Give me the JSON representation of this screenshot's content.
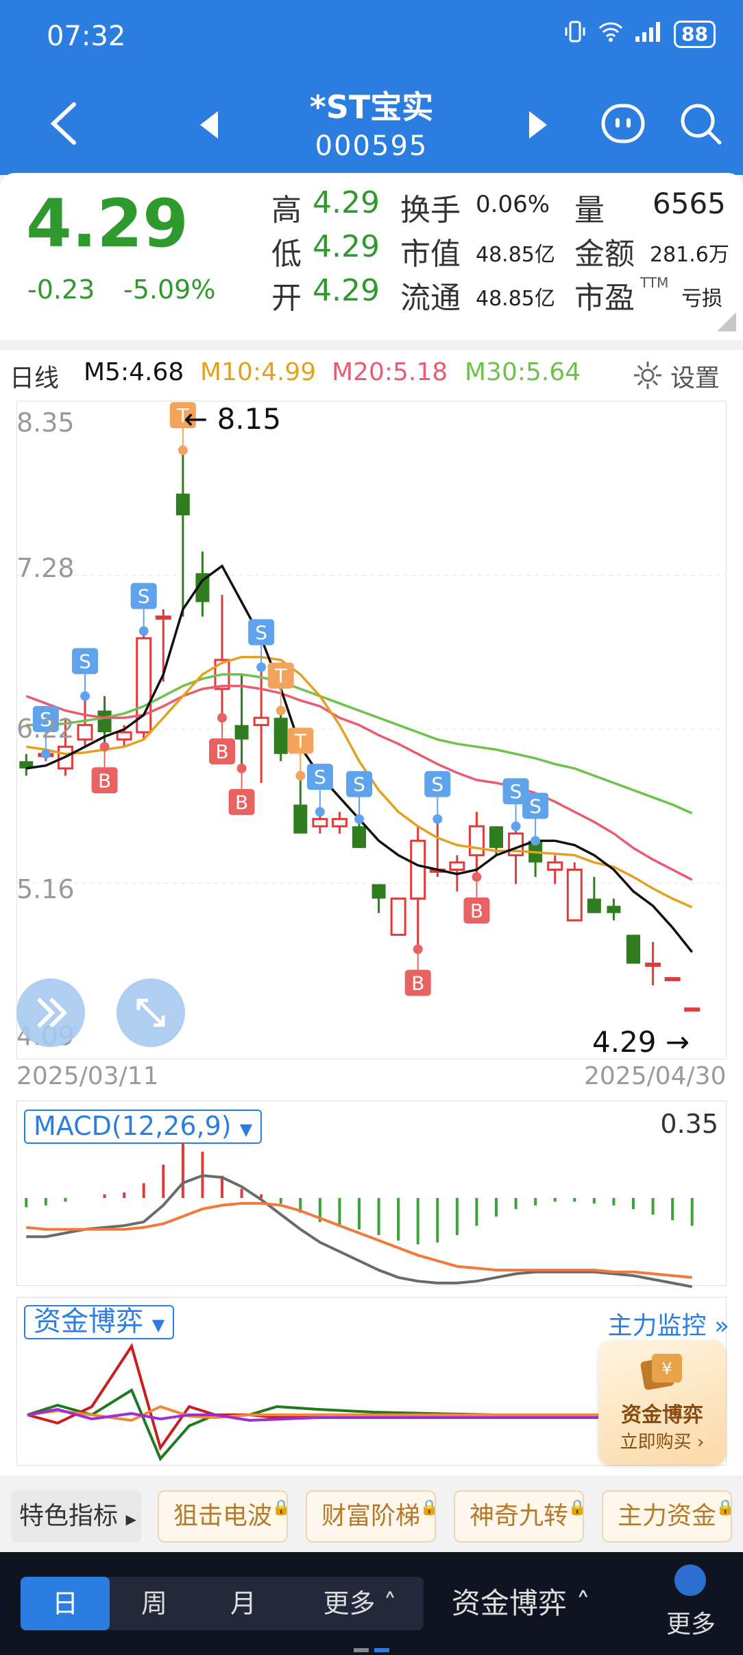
{
  "status": {
    "time": "07:32",
    "battery": "88"
  },
  "header": {
    "title": "*ST宝实",
    "code": "000595"
  },
  "quote": {
    "price": "4.29",
    "change": "-0.23",
    "change_pct": "-5.09%",
    "high_label": "高",
    "high": "4.29",
    "low_label": "低",
    "low": "4.29",
    "open_label": "开",
    "open": "4.29",
    "turnover_label": "换手",
    "turnover": "0.06%",
    "mktcap_label": "市值",
    "mktcap": "48.85亿",
    "float_label": "流通",
    "float": "48.85亿",
    "volume_label": "量",
    "volume": "6565",
    "amount_label": "金额",
    "amount": "281.6万",
    "pe_label": "市盈",
    "pe_sup": "TTM",
    "pe": "亏损"
  },
  "ma_row": {
    "period": "日线",
    "m5": "M5:4.68",
    "m10": "M10:4.99",
    "m20": "M20:5.18",
    "m30": "M30:5.64",
    "settings": "设置"
  },
  "colors": {
    "up": "#e03a3a",
    "down": "#2f7d1f",
    "m5": "#111111",
    "m10": "#e6a020",
    "m20": "#ec5a72",
    "m30": "#6cc24a",
    "accent": "#2b7de0"
  },
  "chart_data": {
    "type": "candlestick",
    "y_ticks": [
      "8.35",
      "7.28",
      "6.22",
      "5.16",
      "4.09"
    ],
    "ylim": [
      4.09,
      8.35
    ],
    "date_start": "2025/03/11",
    "date_end": "2025/04/30",
    "max_label": "8.15",
    "min_label": "4.29",
    "candles": [
      [
        6.0,
        6.05,
        5.9,
        5.95
      ],
      [
        6.05,
        6.05,
        6.0,
        6.05
      ],
      [
        5.95,
        6.3,
        5.9,
        6.1
      ],
      [
        6.15,
        6.45,
        6.1,
        6.25
      ],
      [
        6.35,
        6.45,
        6.1,
        6.2
      ],
      [
        6.15,
        6.25,
        6.1,
        6.2
      ],
      [
        6.2,
        6.9,
        6.15,
        6.85
      ],
      [
        7.0,
        7.05,
        6.55,
        7.0
      ],
      [
        7.85,
        8.15,
        7.0,
        7.7
      ],
      [
        7.3,
        7.45,
        7.0,
        7.1
      ],
      [
        6.5,
        7.15,
        6.3,
        6.7
      ],
      [
        6.25,
        6.6,
        5.95,
        6.15
      ],
      [
        6.25,
        6.65,
        5.85,
        6.3
      ],
      [
        6.3,
        6.35,
        6.0,
        6.05
      ],
      [
        5.7,
        5.9,
        5.5,
        5.5
      ],
      [
        5.55,
        5.65,
        5.5,
        5.6
      ],
      [
        5.55,
        5.65,
        5.5,
        5.6
      ],
      [
        5.55,
        5.6,
        5.4,
        5.4
      ],
      [
        5.15,
        5.15,
        4.95,
        5.05
      ],
      [
        4.8,
        5.05,
        4.8,
        5.05
      ],
      [
        5.05,
        5.55,
        4.7,
        5.45
      ],
      [
        5.25,
        5.6,
        5.2,
        5.25
      ],
      [
        5.25,
        5.35,
        5.1,
        5.3
      ],
      [
        5.35,
        5.65,
        5.2,
        5.55
      ],
      [
        5.55,
        5.55,
        5.35,
        5.4
      ],
      [
        5.35,
        5.55,
        5.15,
        5.5
      ],
      [
        5.45,
        5.45,
        5.2,
        5.3
      ],
      [
        5.25,
        5.35,
        5.15,
        5.3
      ],
      [
        4.9,
        5.3,
        4.9,
        5.25
      ],
      [
        5.05,
        5.2,
        4.95,
        4.95
      ],
      [
        5.0,
        5.05,
        4.9,
        4.95
      ],
      [
        4.8,
        4.8,
        4.6,
        4.6
      ],
      [
        4.6,
        4.75,
        4.45,
        4.6
      ],
      [
        4.5,
        4.5,
        4.5,
        4.5
      ],
      [
        4.29,
        4.29,
        4.29,
        4.29
      ]
    ],
    "m5": [
      5.95,
      5.97,
      6.03,
      6.1,
      6.17,
      6.22,
      6.32,
      6.6,
      7.05,
      7.25,
      7.35,
      7.1,
      6.85,
      6.5,
      6.1,
      5.9,
      5.75,
      5.6,
      5.45,
      5.35,
      5.28,
      5.25,
      5.22,
      5.25,
      5.35,
      5.4,
      5.45,
      5.45,
      5.42,
      5.35,
      5.25,
      5.1,
      5.0,
      4.85,
      4.68
    ],
    "m10": [
      6.1,
      6.08,
      6.05,
      6.06,
      6.08,
      6.1,
      6.15,
      6.3,
      6.45,
      6.6,
      6.68,
      6.72,
      6.72,
      6.7,
      6.6,
      6.45,
      6.25,
      6.0,
      5.8,
      5.65,
      5.55,
      5.47,
      5.42,
      5.4,
      5.38,
      5.38,
      5.37,
      5.36,
      5.35,
      5.3,
      5.27,
      5.2,
      5.12,
      5.05,
      4.99
    ],
    "m20": [
      6.45,
      6.4,
      6.35,
      6.32,
      6.3,
      6.3,
      6.32,
      6.38,
      6.45,
      6.5,
      6.52,
      6.52,
      6.5,
      6.47,
      6.42,
      6.38,
      6.3,
      6.25,
      6.18,
      6.12,
      6.05,
      5.98,
      5.92,
      5.87,
      5.85,
      5.82,
      5.78,
      5.72,
      5.65,
      5.58,
      5.5,
      5.4,
      5.32,
      5.25,
      5.18
    ],
    "m30": [
      6.25,
      6.25,
      6.26,
      6.28,
      6.3,
      6.33,
      6.38,
      6.45,
      6.52,
      6.57,
      6.6,
      6.6,
      6.58,
      6.55,
      6.5,
      6.45,
      6.4,
      6.35,
      6.3,
      6.25,
      6.2,
      6.15,
      6.12,
      6.1,
      6.08,
      6.05,
      6.02,
      5.98,
      5.95,
      5.9,
      5.85,
      5.8,
      5.75,
      5.7,
      5.64
    ],
    "markers": [
      {
        "i": 1,
        "type": "S"
      },
      {
        "i": 3,
        "type": "S"
      },
      {
        "i": 4,
        "type": "B"
      },
      {
        "i": 6,
        "type": "S"
      },
      {
        "i": 8,
        "type": "T"
      },
      {
        "i": 10,
        "type": "B"
      },
      {
        "i": 11,
        "type": "B"
      },
      {
        "i": 12,
        "type": "S"
      },
      {
        "i": 13,
        "type": "T"
      },
      {
        "i": 14,
        "type": "T"
      },
      {
        "i": 15,
        "type": "S"
      },
      {
        "i": 17,
        "type": "S"
      },
      {
        "i": 20,
        "type": "B"
      },
      {
        "i": 21,
        "type": "S"
      },
      {
        "i": 23,
        "type": "B"
      },
      {
        "i": 25,
        "type": "S"
      },
      {
        "i": 26,
        "type": "S"
      }
    ],
    "macd": {
      "label": "MACD(12,26,9)",
      "value": "0.35",
      "bars": [
        -0.05,
        -0.04,
        -0.02,
        0.0,
        0.02,
        0.03,
        0.08,
        0.18,
        0.3,
        0.25,
        0.12,
        0.05,
        0.02,
        -0.03,
        -0.08,
        -0.13,
        -0.15,
        -0.17,
        -0.2,
        -0.23,
        -0.25,
        -0.24,
        -0.2,
        -0.15,
        -0.1,
        -0.06,
        -0.04,
        -0.02,
        -0.02,
        -0.03,
        -0.04,
        -0.06,
        -0.09,
        -0.12,
        -0.15
      ],
      "dif": [
        -0.12,
        -0.12,
        -0.1,
        -0.08,
        -0.07,
        -0.06,
        -0.04,
        0.05,
        0.17,
        0.21,
        0.2,
        0.15,
        0.08,
        0.0,
        -0.08,
        -0.15,
        -0.2,
        -0.25,
        -0.3,
        -0.34,
        -0.36,
        -0.37,
        -0.37,
        -0.36,
        -0.34,
        -0.32,
        -0.31,
        -0.31,
        -0.31,
        -0.31,
        -0.32,
        -0.33,
        -0.35,
        -0.37,
        -0.39
      ],
      "dea": [
        -0.07,
        -0.08,
        -0.08,
        -0.08,
        -0.08,
        -0.08,
        -0.07,
        -0.05,
        -0.01,
        0.03,
        0.05,
        0.06,
        0.06,
        0.05,
        0.02,
        -0.02,
        -0.06,
        -0.1,
        -0.14,
        -0.18,
        -0.22,
        -0.25,
        -0.28,
        -0.29,
        -0.3,
        -0.3,
        -0.3,
        -0.3,
        -0.3,
        -0.3,
        -0.31,
        -0.31,
        -0.32,
        -0.33,
        -0.34
      ]
    }
  },
  "macd_panel": {
    "label": "MACD(12,26,9)",
    "value": "0.35"
  },
  "fund_panel": {
    "label": "资金博弈",
    "monitor": "主力监控"
  },
  "promo": {
    "title": "资金博弈",
    "cta": "立即购买"
  },
  "features": {
    "first": "特色指标",
    "items": [
      "狙击电波",
      "财富阶梯",
      "神奇九转",
      "主力资金"
    ]
  },
  "bottom_bar": {
    "tabs": [
      "日",
      "周",
      "月",
      "更多"
    ],
    "fund": "资金博弈",
    "more": "更多"
  }
}
